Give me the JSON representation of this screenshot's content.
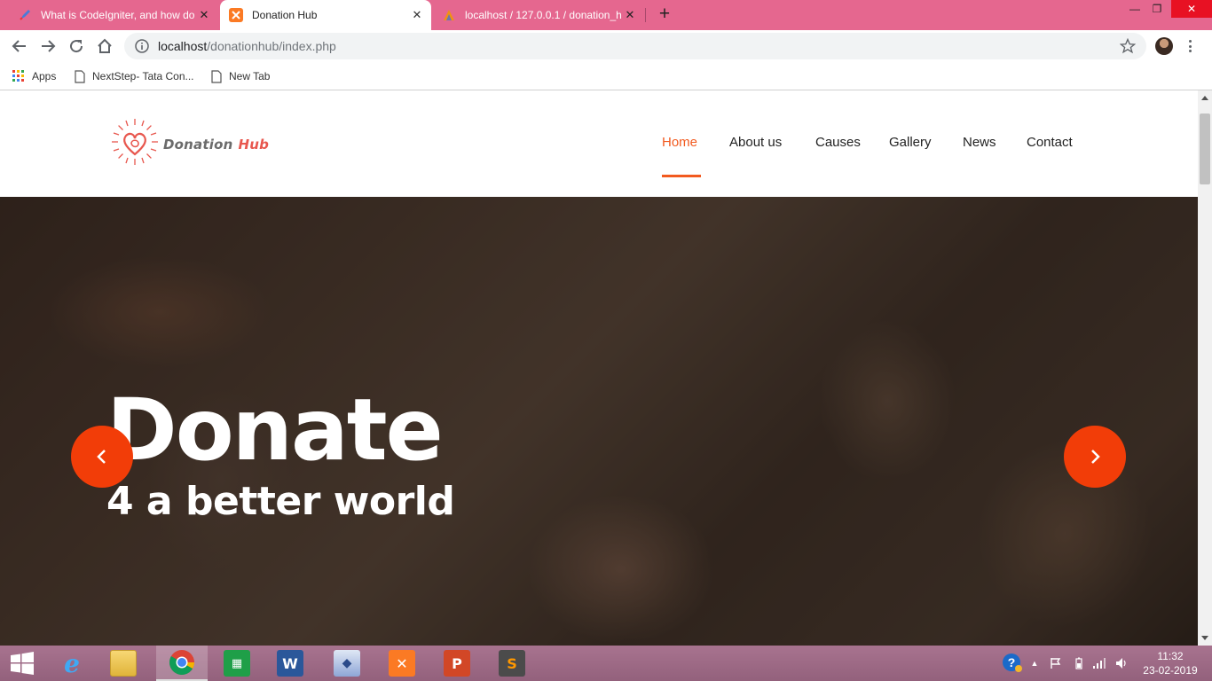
{
  "browser": {
    "tabs": [
      {
        "title": "What is CodeIgniter, and how do",
        "active": false
      },
      {
        "title": "Donation Hub",
        "active": true
      },
      {
        "title": "localhost / 127.0.0.1 / donation_h",
        "active": false
      }
    ],
    "new_tab_symbol": "+",
    "window_controls": {
      "minimize": "—",
      "maximize": "❐",
      "close": "✕"
    },
    "url": {
      "host": "localhost",
      "path": "/donationhub/index.php"
    },
    "bookmarks": [
      {
        "label": "Apps",
        "icon": "apps-grid-icon"
      },
      {
        "label": "NextStep- Tata Con...",
        "icon": "page-icon"
      },
      {
        "label": "New Tab",
        "icon": "page-icon"
      }
    ]
  },
  "site": {
    "logo": {
      "word1": "Donation",
      "word2": "Hub",
      "icon": "heart-sun-icon"
    },
    "nav": [
      "Home",
      "About us",
      "Causes",
      "Gallery",
      "News",
      "Contact"
    ],
    "active_nav": "Home",
    "hero": {
      "title": "Donate",
      "subtitle": "4 a better world"
    },
    "colors": {
      "accent": "#f25a1f",
      "arrow": "#f23d08",
      "logo_hub": "#e8574e"
    }
  },
  "taskbar": {
    "apps": [
      "start-icon",
      "internet-explorer-icon",
      "file-explorer-icon",
      "chrome-icon",
      "store-icon",
      "word-icon",
      "media-icon",
      "xampp-icon",
      "powerpoint-icon",
      "sublime-text-icon"
    ],
    "active_app": "chrome-icon",
    "clock": {
      "time": "11:32",
      "date": "23-02-2019"
    }
  }
}
